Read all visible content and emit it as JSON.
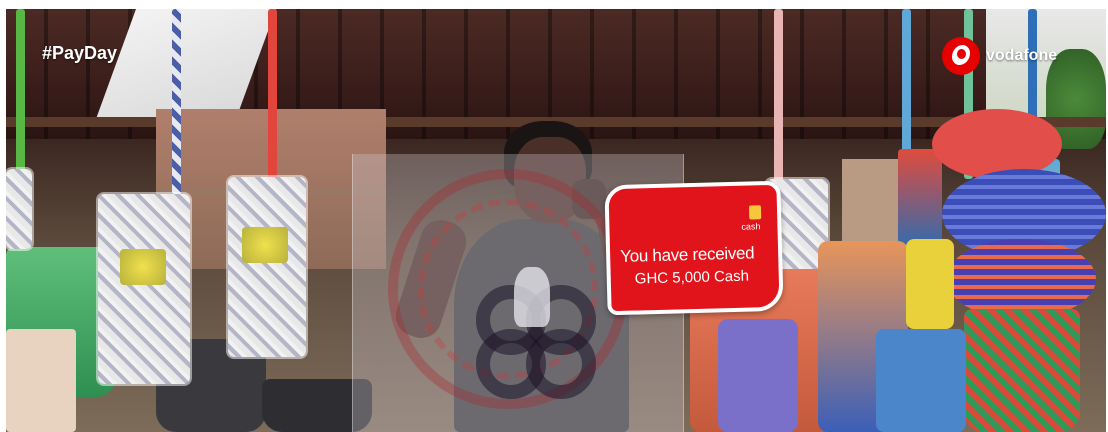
{
  "overlay": {
    "hashtag": "#PayDay",
    "brand_name": "vodafone"
  },
  "notice": {
    "icon_label": "cash",
    "line1": "You have received",
    "line2": "GHC 5,000 Cash"
  },
  "colors": {
    "brand_red": "#e60000",
    "notice_red": "#e1141b",
    "notice_border": "#ffffff",
    "text": "#ffffff"
  },
  "icons": [
    "vodafone-logo-icon",
    "cash-icon",
    "adinkra-watermark-icon"
  ]
}
